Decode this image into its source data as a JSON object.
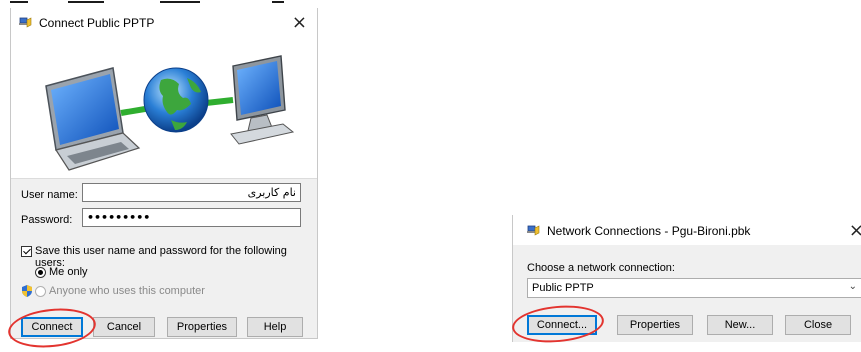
{
  "connect_dialog": {
    "title": "Connect Public PPTP",
    "close": "×",
    "username_label": "User name:",
    "username_value": "نام کاربری",
    "password_label": "Password:",
    "password_value": "•••••••••",
    "save_label": "Save this user name and password for the following users:",
    "save_checked": true,
    "radio_me": "Me only",
    "radio_anyone": "Anyone who uses this computer",
    "buttons": {
      "connect": "Connect",
      "cancel": "Cancel",
      "properties": "Properties",
      "help": "Help"
    }
  },
  "network_dialog": {
    "title": "Network Connections - Pgu-Bironi.pbk",
    "close": "×",
    "choose_label": "Choose a network connection:",
    "selected": "Public PPTP",
    "buttons": {
      "connect": "Connect...",
      "properties": "Properties",
      "new": "New...",
      "close": "Close"
    }
  },
  "colors": {
    "highlight_circle": "#e3342f",
    "focus_border": "#0078d7"
  }
}
